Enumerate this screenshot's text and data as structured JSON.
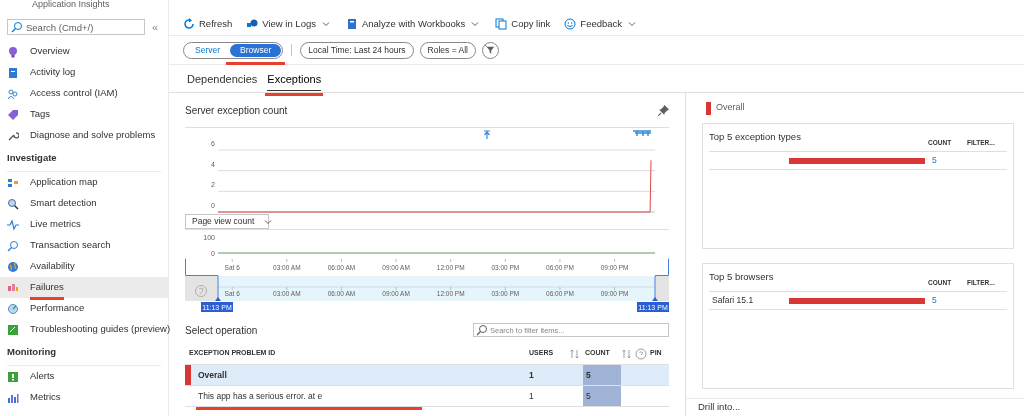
{
  "app_title": "Application Insights",
  "sidebar": {
    "search": {
      "placeholder": "Search (Cmd+/)"
    },
    "collapse": "«",
    "groups": [
      {
        "items": [
          {
            "label": "Overview",
            "kind": "bulb",
            "selected": false,
            "underlined": false
          },
          {
            "label": "Activity log",
            "kind": "log",
            "selected": false,
            "underlined": false
          },
          {
            "label": "Access control (IAM)",
            "kind": "people",
            "selected": false,
            "underlined": false
          },
          {
            "label": "Tags",
            "kind": "tag",
            "selected": false,
            "underlined": false
          },
          {
            "label": "Diagnose and solve problems",
            "kind": "wrench",
            "selected": false,
            "underlined": false
          }
        ]
      },
      {
        "heading": "Investigate",
        "items": [
          {
            "label": "Application map",
            "kind": "map",
            "selected": false,
            "underlined": false
          },
          {
            "label": "Smart detection",
            "kind": "detect",
            "selected": false,
            "underlined": false
          },
          {
            "label": "Live metrics",
            "kind": "pulse",
            "selected": false,
            "underlined": false
          },
          {
            "label": "Transaction search",
            "kind": "search",
            "selected": false,
            "underlined": false
          },
          {
            "label": "Availability",
            "kind": "globe",
            "selected": false,
            "underlined": false
          },
          {
            "label": "Failures",
            "kind": "failures",
            "selected": true,
            "underlined": true
          },
          {
            "label": "Performance",
            "kind": "gauge",
            "selected": false,
            "underlined": false
          },
          {
            "label": "Troubleshooting guides (preview)",
            "kind": "guide",
            "selected": false,
            "underlined": false
          }
        ]
      },
      {
        "heading": "Monitoring",
        "items": [
          {
            "label": "Alerts",
            "kind": "alert",
            "selected": false,
            "underlined": false
          },
          {
            "label": "Metrics",
            "kind": "metrics",
            "selected": false,
            "underlined": false
          }
        ]
      }
    ]
  },
  "toolbar": [
    {
      "label": "Refresh",
      "kind": "refresh",
      "dropdown": false
    },
    {
      "label": "View in Logs",
      "kind": "logs",
      "dropdown": true
    },
    {
      "label": "Analyze with Workbooks",
      "kind": "workbook",
      "dropdown": true
    },
    {
      "label": "Copy link",
      "kind": "copy",
      "dropdown": false
    },
    {
      "label": "Feedback",
      "kind": "smile",
      "dropdown": true
    }
  ],
  "filters": {
    "toggle": [
      {
        "label": "Server",
        "selected": false,
        "underlined": false
      },
      {
        "label": "Browser",
        "selected": true,
        "underlined": true
      }
    ],
    "pills": [
      "Local Time: Last 24 hours",
      "Roles = All"
    ]
  },
  "tabs": [
    {
      "label": "Dependencies",
      "selected": false,
      "underlined": false
    },
    {
      "label": "Exceptions",
      "selected": true,
      "underlined": true
    }
  ],
  "exception_chart": {
    "title": "Server exception count",
    "chart_data": {
      "type": "line",
      "x": [
        -0.78,
        22.95,
        23.0
      ],
      "series": [
        {
          "color": "#e04848",
          "values": [
            0,
            0,
            5
          ]
        }
      ],
      "xlim": [
        -0.78,
        23.22
      ],
      "ylim": [
        0,
        6
      ],
      "yticks": [
        0,
        2,
        4,
        6
      ]
    }
  },
  "page_view_chart": {
    "metric": "Page view count",
    "chart_data": {
      "type": "line",
      "x": [
        -0.78,
        23.22
      ],
      "series": [
        {
          "color": "#5a9e5a",
          "values": [
            0,
            0
          ]
        }
      ],
      "xlim": [
        -0.78,
        23.22
      ],
      "ylim": [
        0,
        100
      ],
      "yticks": [
        0,
        100
      ],
      "xticks": [
        {
          "value": 0,
          "label": "Sat 6"
        },
        {
          "value": 3,
          "label": "03:00 AM"
        },
        {
          "value": 6,
          "label": "06:00 AM"
        },
        {
          "value": 9,
          "label": "09:00 AM"
        },
        {
          "value": 12,
          "label": "12:00 PM"
        },
        {
          "value": 15,
          "label": "03:00 PM"
        },
        {
          "value": 18,
          "label": "06:00 PM"
        },
        {
          "value": 21,
          "label": "09:00 PM"
        }
      ]
    }
  },
  "timeline": {
    "labels": [
      "Sat 6",
      "03:00 AM",
      "06:00 AM",
      "09:00 AM",
      "12:00 PM",
      "03:00 PM",
      "06:00 PM",
      "09:00 PM"
    ],
    "range_start": "11:13 PM",
    "range_end": "11:13 PM"
  },
  "operations": {
    "title": "Select operation",
    "search": {
      "placeholder": "Search to filter items..."
    },
    "columns": [
      "EXCEPTION PROBLEM ID",
      "USERS",
      "COUNT",
      "PIN"
    ],
    "rows": [
      {
        "name": "Overall",
        "users": "1",
        "count": "5",
        "selected": true,
        "underlined": false
      },
      {
        "name": "This app has a serious error. at e",
        "users": "1",
        "count": "5",
        "selected": false,
        "underlined": true
      }
    ]
  },
  "details": {
    "legend": "Overall",
    "cards": [
      {
        "title": "Top 5 exception types",
        "columns": [
          "COUNT",
          "FILTER..."
        ],
        "rows": [
          {
            "count": "5",
            "level": 1
          }
        ]
      },
      {
        "title": "Top 5 browsers",
        "columns": [
          "COUNT",
          "FILTER..."
        ],
        "rows": [
          {
            "label": "Safari 15.1",
            "count": "5",
            "level": 1
          }
        ]
      }
    ],
    "drill": "Drill into..."
  }
}
